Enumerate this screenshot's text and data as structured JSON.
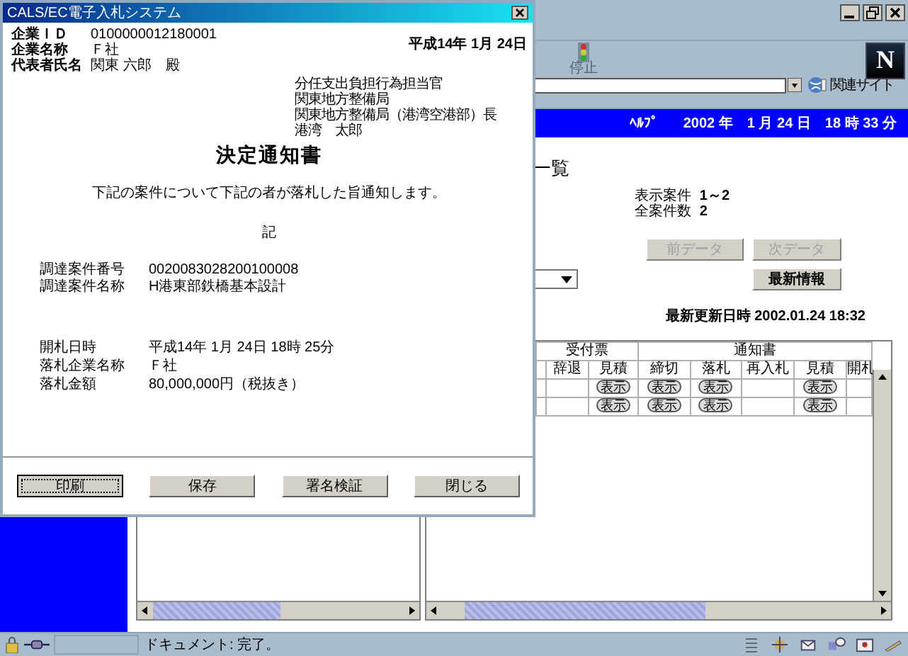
{
  "browser": {
    "stop_label": "停止",
    "logo_letter": "N",
    "related_sites": "関連サイト",
    "header": {
      "help": "ﾍﾙﾌﾟ",
      "datetime": "2002 年　1 月 24 日　18 時 33 分"
    },
    "page_title": "一覧",
    "counts": [
      {
        "label": "表示案件",
        "value": "1～2"
      },
      {
        "label": "全案件数",
        "value": "2"
      }
    ],
    "nav_buttons": [
      {
        "label": "前データ",
        "disabled": true
      },
      {
        "label": "次データ",
        "disabled": true
      }
    ],
    "refresh_button": "最新情報",
    "last_updated": "最新更新日時 2002.01.24 18:32",
    "table": {
      "groups": [
        "受付票",
        "通知書"
      ],
      "columns": [
        "辞退",
        "見積",
        "締切",
        "落札",
        "再入札",
        "見積",
        "開札"
      ],
      "rows": [
        [
          null,
          "表示",
          "表示",
          "表示",
          null,
          "表示",
          null
        ],
        [
          null,
          "表示",
          "表示",
          "表示",
          null,
          "表示",
          null
        ]
      ]
    },
    "status_bar": "ドキュメント: 完了。"
  },
  "dialog": {
    "title": "CALS/EC電子入札システム",
    "recipient": [
      {
        "label": "企業ＩＤ",
        "value": "0100000012180001"
      },
      {
        "label": "企業名称",
        "value": "Ｆ社"
      },
      {
        "label": "代表者氏名",
        "value": "関東 六郎　殿"
      }
    ],
    "date": "平成14年 1月 24日",
    "sender": [
      "分任支出負担行為担当官",
      "関東地方整備局",
      "関東地方整備局（港湾空港部）長",
      "港湾　太郎"
    ],
    "heading": "決定通知書",
    "message": "下記の案件について下記の者が落札した旨通知します。",
    "note_mark": "記",
    "case_fields": [
      {
        "label": "調達案件番号",
        "value": "0020083028200100008"
      },
      {
        "label": "調達案件名称",
        "value": "H港東部鉄橋基本設計"
      }
    ],
    "result_fields": [
      {
        "label": "開札日時",
        "value": "平成14年 1月 24日 18時 25分"
      },
      {
        "label": "落札企業名称",
        "value": "Ｆ社"
      },
      {
        "label": "落札金額",
        "value": "80,000,000円（税抜き）"
      }
    ],
    "buttons": [
      {
        "label": "印刷",
        "focused": true
      },
      {
        "label": "保存",
        "focused": false
      },
      {
        "label": "署名検証",
        "focused": false
      },
      {
        "label": "閉じる",
        "focused": false
      }
    ]
  }
}
